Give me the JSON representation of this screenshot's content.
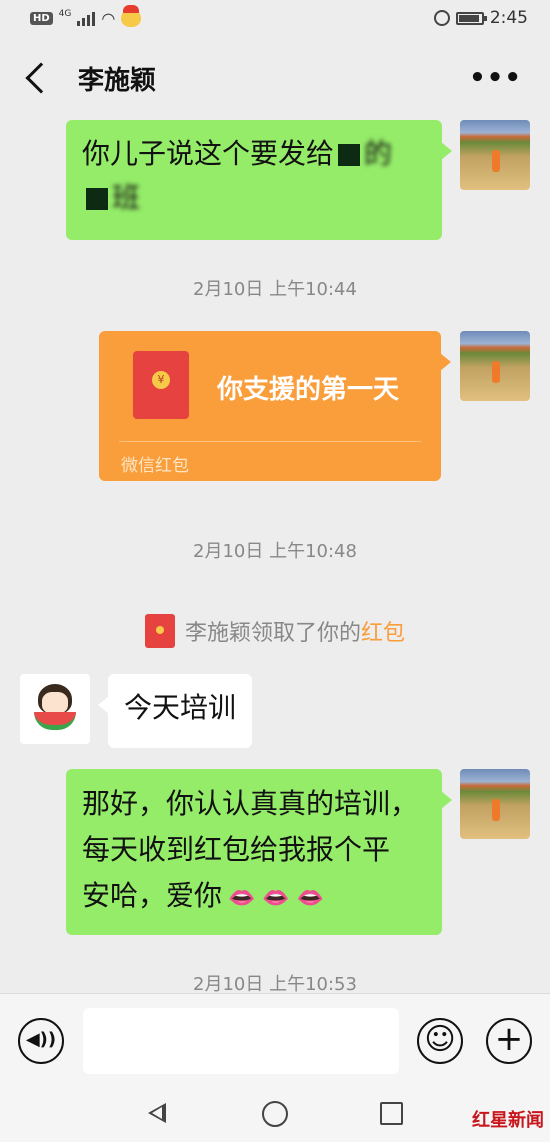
{
  "status_bar": {
    "hd": "HD",
    "network": "4G",
    "time": "2:45"
  },
  "header": {
    "contact_name": "李施颖",
    "more_label": "•••"
  },
  "messages": {
    "m1_line1": "你儿子说这个要发给",
    "m1_tail": "的",
    "m1_line2": "班",
    "ts1": "2月10日 上午10:44",
    "red_packet": {
      "title": "你支援的第一天",
      "footer": "微信红包",
      "seal": "¥"
    },
    "ts2": "2月10日 上午10:48",
    "system_note": {
      "prefix": "李施颖领取了你的",
      "link": "红包"
    },
    "m2": "今天培训",
    "m3_line1": "那好，你认认真真的培训，",
    "m3_line2": "每天收到红包给我报个平",
    "m3_line3": "安哈，爱你",
    "m3_emoji": "👄 👄 👄",
    "ts3": "2月10日 上午10:53"
  },
  "input_bar": {
    "voice_icon": "voice-icon",
    "emoji_icon": "emoji-icon",
    "plus_icon": "plus-icon",
    "plus_label": "+",
    "voice_label": "◀))",
    "emoji_label": "☺"
  },
  "watermark": "红星新闻",
  "colors": {
    "chat_bg": "#ededed",
    "green_bubble": "#95ec69",
    "red_packet": "#fa9d3b",
    "link_orange": "#fa9d3b"
  }
}
